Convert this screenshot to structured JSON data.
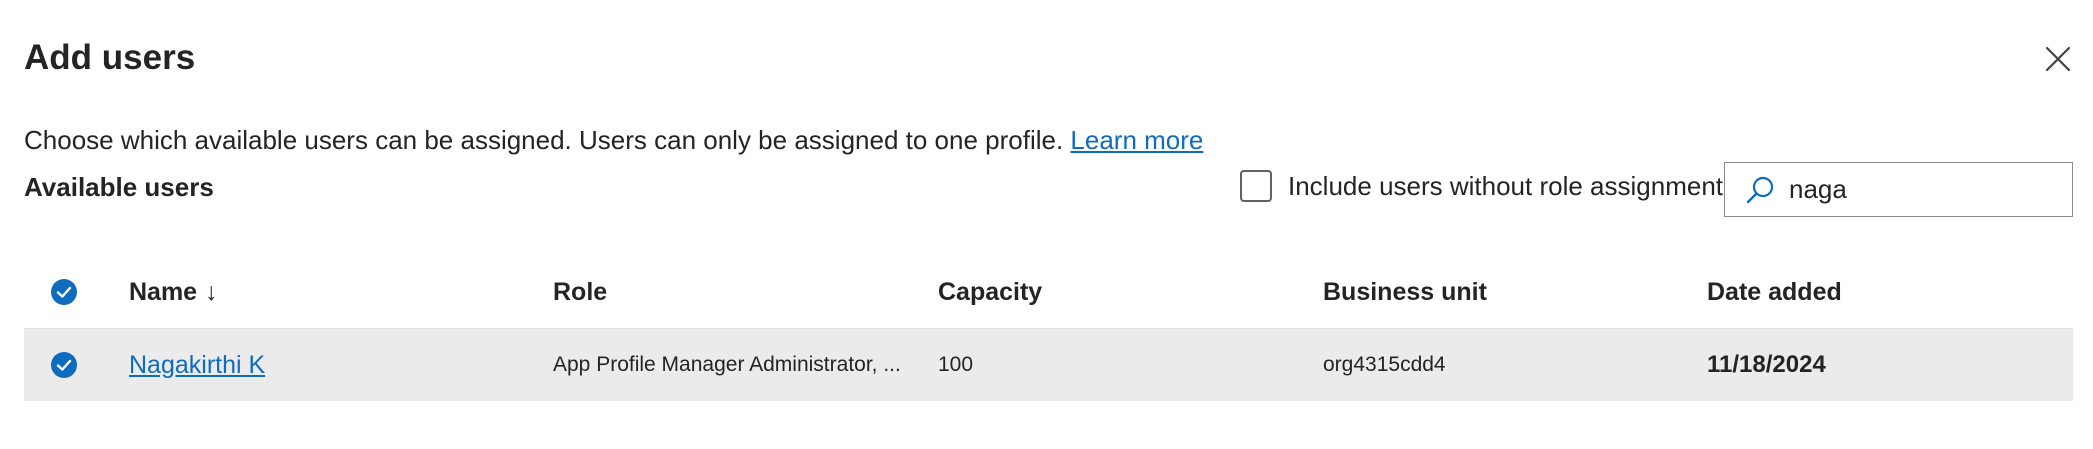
{
  "dialog": {
    "title": "Add users",
    "description": "Choose which available users can be assigned. Users can only be assigned to one profile.",
    "learn_more": "Learn more",
    "section_label": "Available users",
    "include_checkbox_label": "Include users without role assignment",
    "include_checkbox_checked": false,
    "search": {
      "value": "naga",
      "icon": "search-icon"
    },
    "close_icon": "close-icon"
  },
  "table": {
    "columns": {
      "name": "Name",
      "name_sort": "↓",
      "role": "Role",
      "capacity": "Capacity",
      "business_unit": "Business unit",
      "date_added": "Date added"
    },
    "select_all_checked": true,
    "rows": [
      {
        "selected": true,
        "name": "Nagakirthi K",
        "role": "App Profile Manager Administrator, ...",
        "capacity": "100",
        "business_unit": "org4315cdd4",
        "date_added": "11/18/2024"
      }
    ]
  },
  "colors": {
    "accent": "#0f6cbd",
    "row_selected_bg": "#ebebeb",
    "text": "#242424"
  }
}
